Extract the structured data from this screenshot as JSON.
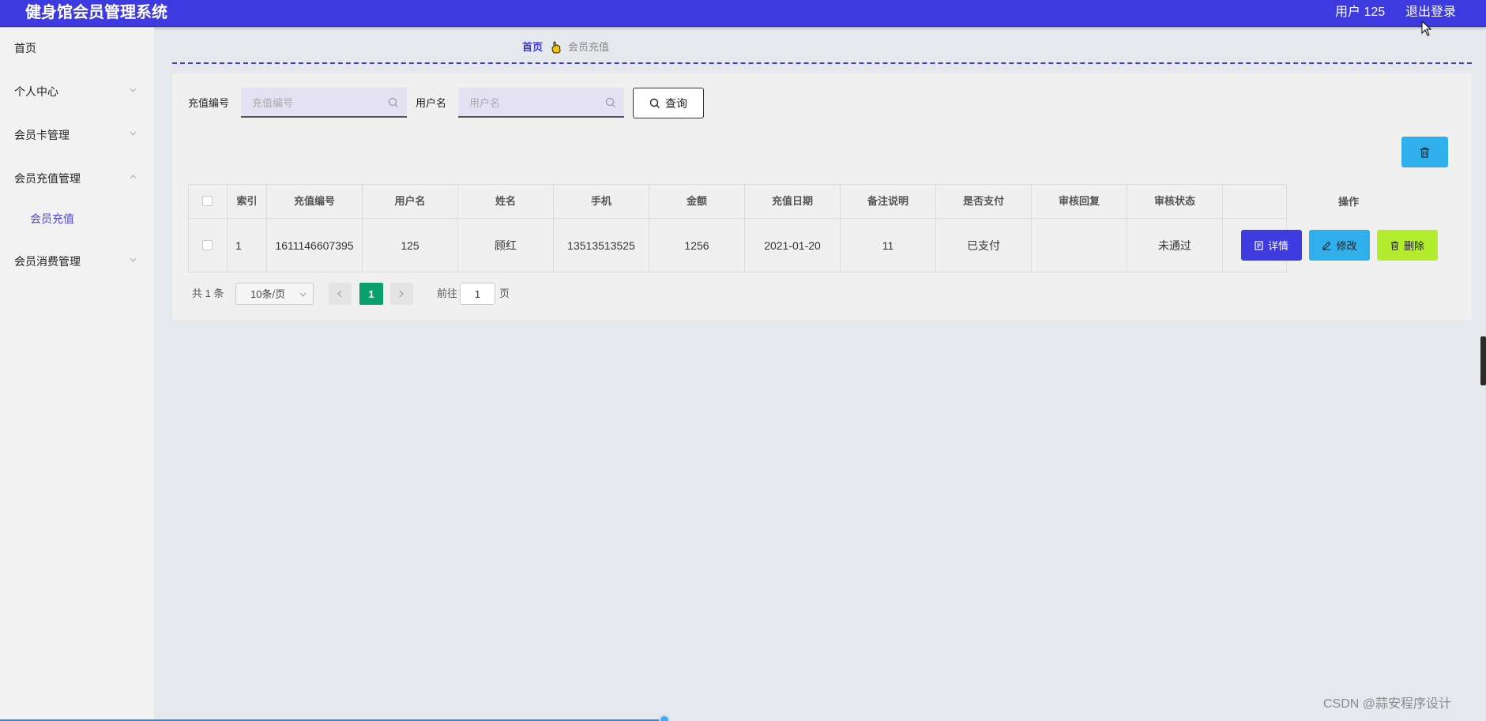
{
  "app": {
    "title": "健身馆会员管理系统",
    "user_label": "用户 125",
    "logout_label": "退出登录"
  },
  "sidebar": {
    "items": [
      {
        "label": "首页"
      },
      {
        "label": "个人中心"
      },
      {
        "label": "会员卡管理"
      },
      {
        "label": "会员充值管理"
      },
      {
        "label": "会员消费管理"
      }
    ],
    "sub_items": [
      {
        "label": "会员充值"
      }
    ]
  },
  "breadcrumb": {
    "home": "首页",
    "current": "会员充值"
  },
  "search": {
    "recharge_no_label": "充值编号",
    "recharge_no_placeholder": "充值编号",
    "username_label": "用户名",
    "username_placeholder": "用户名",
    "query_label": "查询"
  },
  "table": {
    "headers": [
      "索引",
      "充值编号",
      "用户名",
      "姓名",
      "手机",
      "金额",
      "充值日期",
      "备注说明",
      "是否支付",
      "审核回复",
      "审核状态",
      "操作"
    ],
    "rows": [
      {
        "index": "1",
        "recharge_no": "1611146607395",
        "username": "125",
        "name": "顾红",
        "phone": "13513513525",
        "amount": "1256",
        "date": "2021-01-20",
        "remark": "11",
        "paid": "已支付",
        "review_reply": "",
        "review_status": "未通过"
      }
    ],
    "actions": {
      "detail": "详情",
      "edit": "修改",
      "delete": "删除"
    }
  },
  "pagination": {
    "total": "共 1 条",
    "page_size": "10条/页",
    "current_page": "1",
    "goto_label": "前往",
    "goto_value": "1",
    "page_suffix": "页"
  },
  "watermark": "CSDN @蒜安程序设计",
  "colors": {
    "primary": "#3d3be0",
    "info": "#2fb0ec",
    "danger_lime": "#b3ec2d",
    "page_active": "#0aa06e"
  }
}
